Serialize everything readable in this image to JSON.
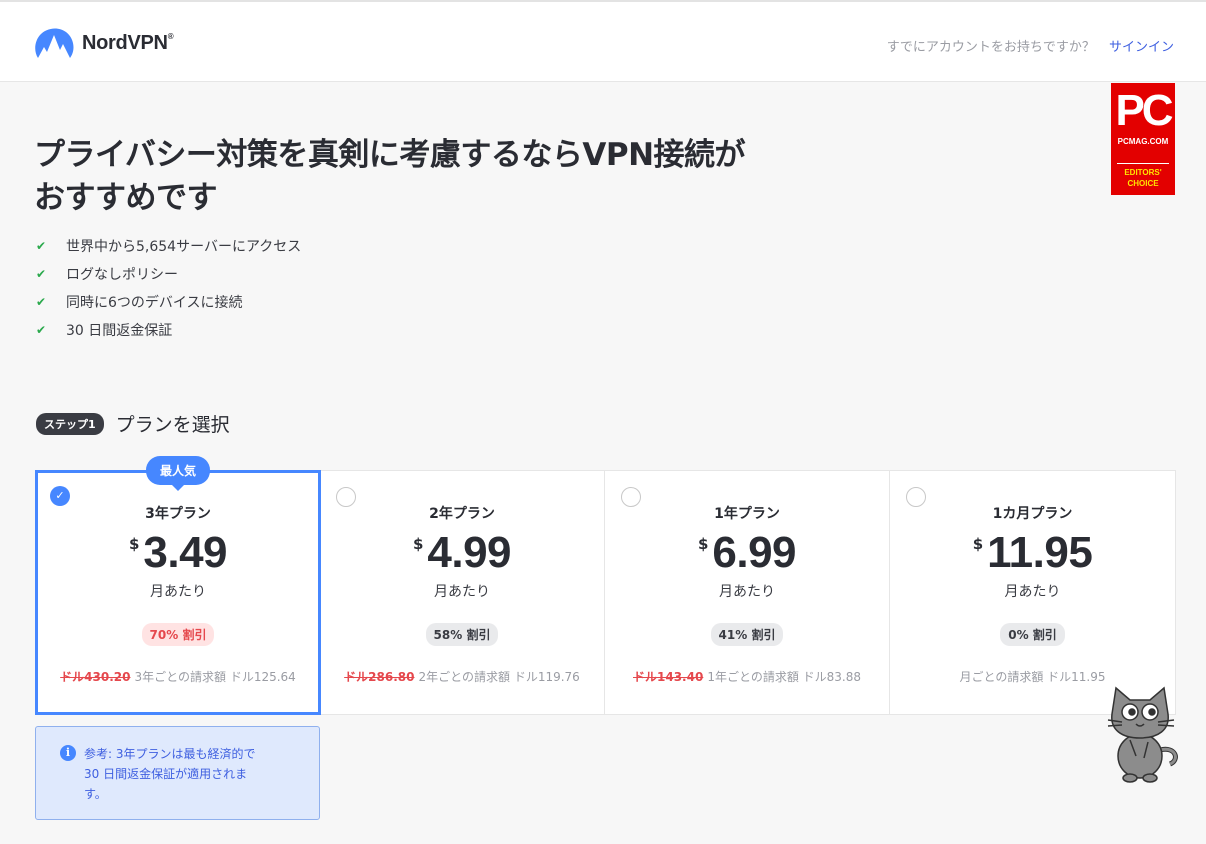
{
  "header": {
    "brand": "NordVPN",
    "brand_mark": "®",
    "signin_prompt": "すでにアカウントをお持ちですか？",
    "signin_link": "サインイン"
  },
  "badge": {
    "pc": "PC",
    "site": "PCMAG.COM",
    "choice_line1": "EDITORS'",
    "choice_line2": "CHOICE"
  },
  "hero": {
    "headline_line1": "プライバシー対策を真剣に考慮するならVPN接続が",
    "headline_line2": "おすすめです",
    "features": [
      "世界中から5,654サーバーにアクセス",
      "ログなしポリシー",
      "同時に6つのデバイスに接続",
      "30 日間返金保証"
    ]
  },
  "step": {
    "badge": "ステップ1",
    "title": "プランを選択"
  },
  "plans": [
    {
      "popular": "最人気",
      "name": "3年プラン",
      "currency": "$",
      "amount": "3.49",
      "per": "月あたり",
      "discount": "70% 割引",
      "old_price": "ドル430.20",
      "billing": "3年ごとの請求額 ドル125.64",
      "selected": "✓"
    },
    {
      "name": "2年プラン",
      "currency": "$",
      "amount": "4.99",
      "per": "月あたり",
      "discount": "58% 割引",
      "old_price": "ドル286.80",
      "billing": "2年ごとの請求額 ドル119.76"
    },
    {
      "name": "1年プラン",
      "currency": "$",
      "amount": "6.99",
      "per": "月あたり",
      "discount": "41% 割引",
      "old_price": "ドル143.40",
      "billing": "1年ごとの請求額 ドル83.88"
    },
    {
      "name": "1カ月プラン",
      "currency": "$",
      "amount": "11.95",
      "per": "月あたり",
      "discount": "0% 割引",
      "old_price": "",
      "billing": "月ごとの請求額 ドル11.95"
    }
  ],
  "note": {
    "icon": "i",
    "text": "参考: 3年プランは最も経済的で 30 日間返金保証が適用されます。"
  },
  "colors": {
    "accent": "#4687ff",
    "link": "#3e5fe0",
    "sale": "#e5484d",
    "check": "#2aa94c",
    "badge_red": "#e30000"
  },
  "icons": [
    "nordvpn-logo-icon",
    "check-icon",
    "radio-icon",
    "info-icon",
    "cat-mascot-icon"
  ]
}
